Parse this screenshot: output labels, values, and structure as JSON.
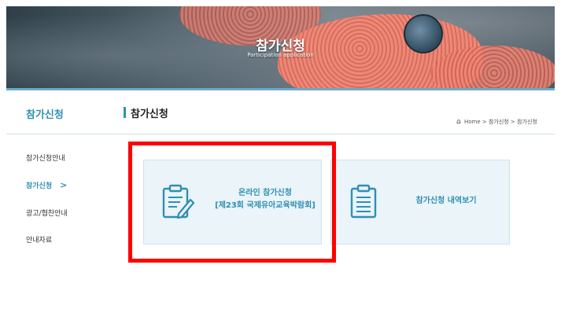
{
  "banner": {
    "title": "참가신청",
    "subtitle": "Participation application"
  },
  "section": {
    "sidebar_title": "참가신청",
    "page_title": "참가신청",
    "breadcrumb": {
      "home": "Home",
      "sep1": ">",
      "level1": "참가신청",
      "sep2": ">",
      "level2": "참가신청"
    }
  },
  "sidebar": {
    "items": [
      {
        "label": "참가신청안내"
      },
      {
        "label": "참가신청",
        "chevron": ">"
      },
      {
        "label": "광고/협찬안내"
      },
      {
        "label": "안내자료"
      }
    ]
  },
  "cards": {
    "online_apply": {
      "line1": "온라인 참가신청",
      "line2": "[제23회 국제유아교육박람회]"
    },
    "history": {
      "label": "참가신청 내역보기"
    }
  },
  "colors": {
    "accent": "#2f8fb3",
    "card_bg": "#eaf4f9",
    "highlight": "#ff0000"
  }
}
